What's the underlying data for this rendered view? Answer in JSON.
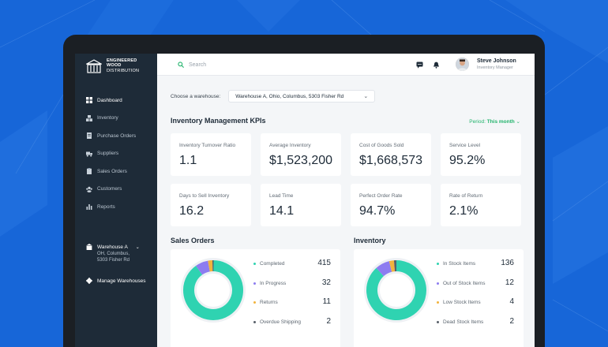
{
  "brand": {
    "line1": "ENGINEERED",
    "line2": "WOOD",
    "line3": "DISTRIBUTION"
  },
  "sidebar": {
    "items": [
      {
        "label": "Dashboard",
        "icon": "grid-icon",
        "active": true
      },
      {
        "label": "Inventory",
        "icon": "boxes-icon"
      },
      {
        "label": "Purchase Orders",
        "icon": "document-icon"
      },
      {
        "label": "Suppliers",
        "icon": "truck-icon"
      },
      {
        "label": "Sales Orders",
        "icon": "clipboard-icon"
      },
      {
        "label": "Customers",
        "icon": "users-icon"
      },
      {
        "label": "Reports",
        "icon": "bar-chart-icon"
      }
    ],
    "warehouse": {
      "name": "Warehouse A",
      "address_line1": "OH, Columbus,",
      "address_line2": "5303 Fisher Rd"
    },
    "manage_label": "Manage Warehouses"
  },
  "search": {
    "placeholder": "Search"
  },
  "user": {
    "name": "Steve Johnson",
    "role": "Inventory Manager"
  },
  "warehouse_select": {
    "label": "Choose a warehouse:",
    "value": "Warehouse A, Ohio, Columbus, 5303 Fisher Rd"
  },
  "kpis": {
    "title": "Inventory Management KPIs",
    "period_label": "Period:",
    "period_value": "This month",
    "cards": [
      {
        "label": "Inventory Turnover Ratio",
        "value": "1.1"
      },
      {
        "label": "Average Inventory",
        "value": "$1,523,200"
      },
      {
        "label": "Cost of Goods Sold",
        "value": "$1,668,573"
      },
      {
        "label": "Service Level",
        "value": "95.2%"
      },
      {
        "label": "Days to Sell Inventory",
        "value": "16.2"
      },
      {
        "label": "Lead Time",
        "value": "14.1"
      },
      {
        "label": "Perfect Order Rate",
        "value": "94.7%"
      },
      {
        "label": "Rate of Return",
        "value": "2.1%"
      }
    ]
  },
  "sales_orders": {
    "title": "Sales Orders",
    "items": [
      {
        "label": "Completed",
        "value": "415",
        "count": 415,
        "color": "#2fd3b1"
      },
      {
        "label": "In Progress",
        "value": "32",
        "count": 32,
        "color": "#8d7cf0"
      },
      {
        "label": "Returns",
        "value": "11",
        "count": 11,
        "color": "#f2b33d"
      },
      {
        "label": "Overdue Shipping",
        "value": "2",
        "count": 2,
        "color": "#58606a"
      }
    ]
  },
  "inventory": {
    "title": "Inventory",
    "items": [
      {
        "label": "In Stock Items",
        "value": "136",
        "count": 136,
        "color": "#2fd3b1"
      },
      {
        "label": "Out of Stock Items",
        "value": "12",
        "count": 12,
        "color": "#8d7cf0"
      },
      {
        "label": "Low Stock Items",
        "value": "4",
        "count": 4,
        "color": "#f2b33d"
      },
      {
        "label": "Dead Stock Items",
        "value": "2",
        "count": 2,
        "color": "#58606a"
      }
    ]
  },
  "colors": {
    "background": "#1766d8",
    "sidebar": "#1e2b38",
    "accent_green": "#21b36b"
  }
}
